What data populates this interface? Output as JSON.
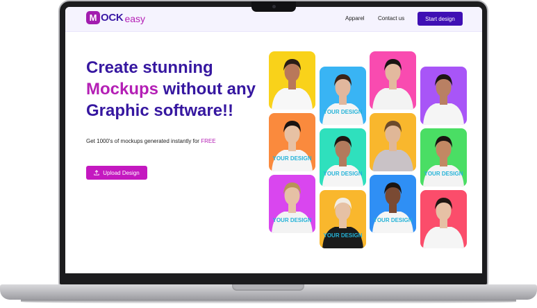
{
  "nav": {
    "logo_m": "M",
    "logo_ock": "OCK",
    "logo_easy": "easy",
    "links": [
      "Apparel",
      "Contact us"
    ],
    "cta": "Start design"
  },
  "hero": {
    "headline_line1": "Create stunning",
    "headline_accent": "Mockups",
    "headline_line2_rest": " without any",
    "headline_line3": "Graphic software!!",
    "subtext": "Get 1000's of mockups generated instantly for ",
    "subtext_highlight": "FREE",
    "upload_label": "Upload Design"
  },
  "tiles": [
    {
      "bg": "#f9d21a",
      "shirt": "#f7f7f7",
      "skin": "#b9785a",
      "hair": "#2a1d16",
      "tag": ""
    },
    {
      "bg": "#39b4f4",
      "shirt": "#f5f5f5",
      "skin": "#e1b79d",
      "hair": "#3a2418",
      "tag": "YOUR DESIGN"
    },
    {
      "bg": "#f94bb0",
      "shirt": "#f3f3f3",
      "skin": "#e3b99e",
      "hair": "#1a1412",
      "tag": ""
    },
    {
      "bg": "#a855f7",
      "shirt": "#f5f5f5",
      "skin": "#b98063",
      "hair": "#1d1613",
      "tag": ""
    },
    {
      "bg": "#fa8a3d",
      "shirt": "#f5f5f5",
      "skin": "#e7c1a4",
      "hair": "#1a1412",
      "tag": "YOUR DESIGN"
    },
    {
      "bg": "#2fe0bd",
      "shirt": "#f5f5f5",
      "skin": "#b27a5c",
      "hair": "#1f1713",
      "tag": "YOUR DESIGN"
    },
    {
      "bg": "#f9b72d",
      "shirt": "#c9c2c6",
      "skin": "#e0b797",
      "hair": "#6b4a2b",
      "tag": ""
    },
    {
      "bg": "#4ade64",
      "shirt": "#f3f3f3",
      "skin": "#c28863",
      "hair": "#1a1412",
      "tag": "YOUR DESIGN"
    },
    {
      "bg": "#d946ef",
      "shirt": "#f3f3f3",
      "skin": "#e6c1a5",
      "hair": "#b89358",
      "tag": "YOUR DESIGN"
    },
    {
      "bg": "#f9b72d",
      "shirt": "#1b1b1b",
      "skin": "#e6c1a5",
      "hair": "#f1ece4",
      "tag": "YOUR DESIGN"
    },
    {
      "bg": "#2f8ff5",
      "shirt": "#f5f5f5",
      "skin": "#7a4a33",
      "hair": "#1a1412",
      "tag": "YOUR DESIGN"
    },
    {
      "bg": "#fb4d6b",
      "shirt": "#f5f5f5",
      "skin": "#e6c1a5",
      "hair": "#1f1713",
      "tag": ""
    }
  ]
}
